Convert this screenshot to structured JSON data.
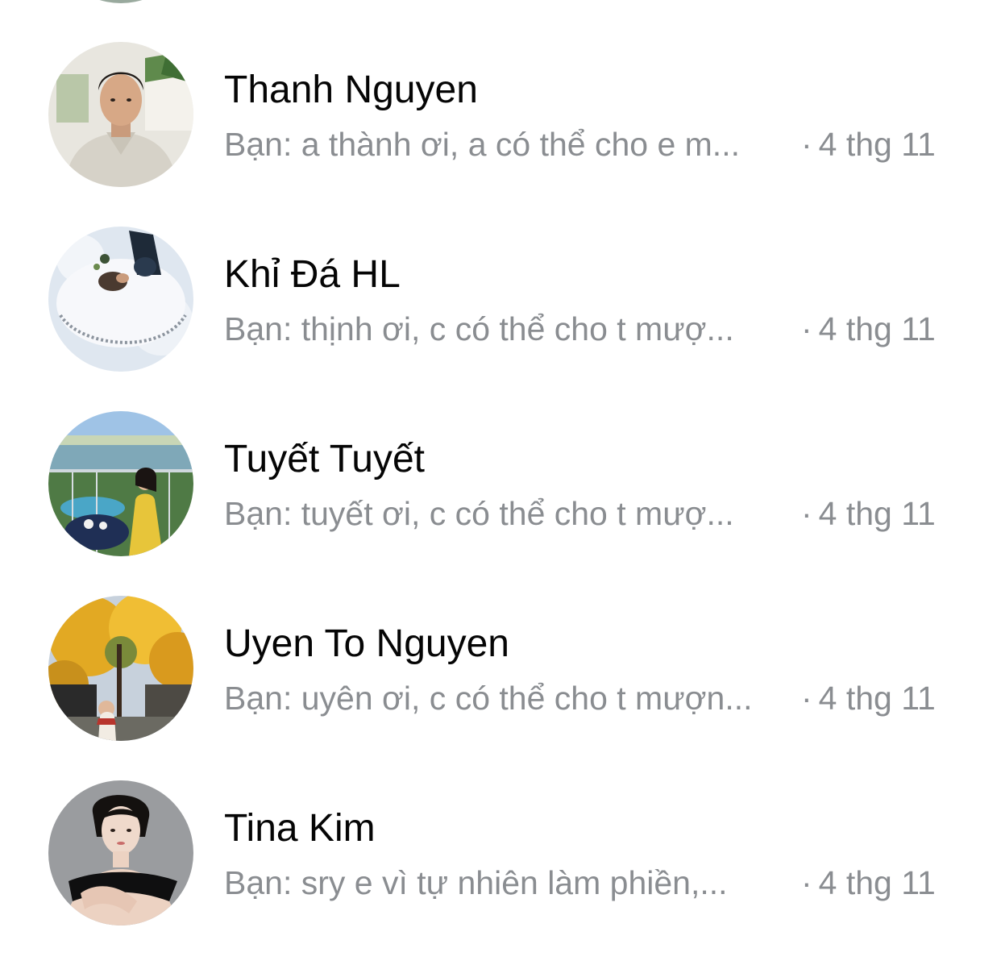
{
  "conversations": [
    {
      "name": "Thanh Nguyen",
      "preview": "Bạn: a thành ơi, a có thể cho e m...",
      "separator": "·",
      "time": "4 thg 11",
      "avatar_icon": "man-portrait-avatar"
    },
    {
      "name": "Khỉ Đá HL",
      "preview": "Bạn: thịnh ơi, c có thể cho t mượ...",
      "separator": "·",
      "time": "4 thg 11",
      "avatar_icon": "snow-couple-avatar"
    },
    {
      "name": "Tuyết Tuyết",
      "preview": "Bạn: tuyết ơi, c có thể cho t mượ...",
      "separator": "·",
      "time": "4 thg 11",
      "avatar_icon": "balcony-woman-avatar"
    },
    {
      "name": "Uyen To Nguyen",
      "preview": "Bạn: uyên ơi, c có thể cho t mượn...",
      "separator": "·",
      "time": "4 thg 11",
      "avatar_icon": "autumn-tree-avatar"
    },
    {
      "name": "Tina Kim",
      "preview": "Bạn: sry e vì tự nhiên làm phiền,...",
      "separator": "·",
      "time": "4 thg 11",
      "avatar_icon": "woman-portrait-avatar"
    }
  ],
  "colors": {
    "name_text": "#050505",
    "secondary_text": "#8a8d91",
    "background": "#ffffff"
  }
}
